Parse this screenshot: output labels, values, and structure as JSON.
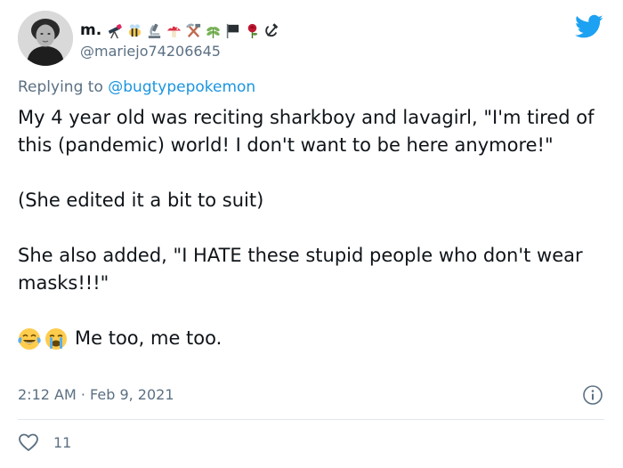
{
  "user": {
    "display_name": "m.",
    "handle": "@mariejo74206645",
    "name_emojis": [
      "telescope-emoji",
      "bee-emoji",
      "microscope-emoji",
      "mushroom-emoji",
      "hammer-pick-emoji",
      "herb-emoji",
      "black-flag-emoji",
      "rose-emoji",
      "hammer-sickle-emoji"
    ]
  },
  "reply": {
    "prefix": "Replying to",
    "mention": "@bugtypepokemon"
  },
  "tweet": {
    "paragraph_1": "My 4 year old was reciting sharkboy and lavagirl, \"I'm tired of this (pandemic) world! I don't want to be here anymore!\"",
    "paragraph_2": "(She edited it a bit to suit)",
    "paragraph_3": "She also added, \"I HATE these stupid people who don't wear masks!!!\"",
    "paragraph_4": "Me too, me too.",
    "paragraph_4_emojis": [
      "tears-of-joy-emoji",
      "loudly-crying-emoji"
    ]
  },
  "meta": {
    "timestamp": "2:12 AM · Feb 9, 2021"
  },
  "actions": {
    "like_count": "11"
  },
  "colors": {
    "twitter_blue": "#1da1f2",
    "link_blue": "#1b95e0",
    "secondary_text": "#5b7083",
    "divider": "#e1e8ed"
  }
}
